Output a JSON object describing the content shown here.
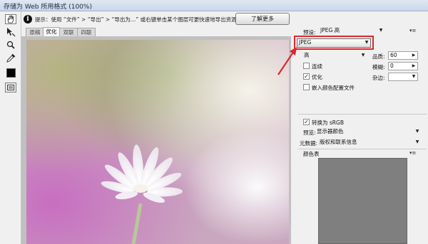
{
  "window": {
    "title": "存储为 Web 所用格式 (100%)"
  },
  "tools": [
    {
      "name": "hand-tool"
    },
    {
      "name": "slice-select-tool"
    },
    {
      "name": "zoom-tool"
    },
    {
      "name": "eyedropper-tool"
    },
    {
      "name": "eyedropper-color"
    },
    {
      "name": "toggle-slices-visibility"
    }
  ],
  "info": {
    "text": "提示：使用 “文件” > “导出” > “导出为…” 或右键单击某个图层可更快速地导出资源",
    "button": "了解更多"
  },
  "tabs": [
    {
      "label": "原稿",
      "active": false
    },
    {
      "label": "优化",
      "active": true
    },
    {
      "label": "双联",
      "active": false
    },
    {
      "label": "四联",
      "active": false
    }
  ],
  "preview": {
    "image": "white daisy on pink-green blurred background"
  },
  "panel": {
    "preset_label": "预设:",
    "preset_value": "JPEG 高",
    "format_value": "JPEG",
    "quality_level": "高",
    "quality_label": "品质:",
    "quality_value": "60",
    "progressive_label": "连续",
    "progressive_checked": false,
    "blur_label": "模糊:",
    "blur_value": "0",
    "optimized_label": "优化",
    "optimized_checked": true,
    "matte_label": "杂边:",
    "embed_profile_label": "嵌入颜色配置文件",
    "embed_profile_checked": false,
    "convert_srgb_label": "转换为 sRGB",
    "convert_srgb_checked": true,
    "preview_label": "预览:",
    "preview_value": "显示器颜色",
    "metadata_label": "元数据:",
    "metadata_value": "版权和联系信息",
    "color_table_label": "颜色表"
  },
  "colors": {
    "highlight": "#e0262c",
    "arrow": "#e0262c",
    "color_table_bg": "#7f7f7f"
  }
}
